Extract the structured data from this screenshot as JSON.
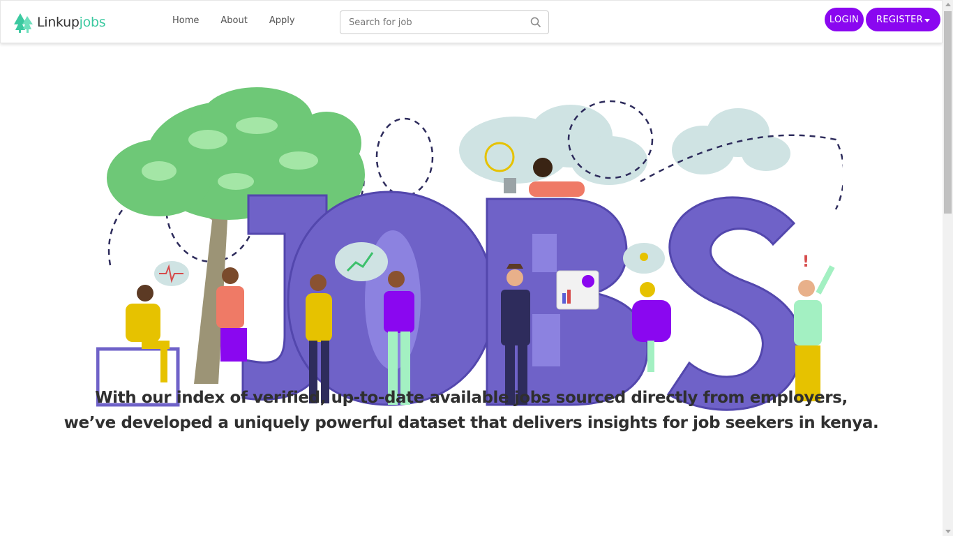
{
  "brand": {
    "part1": "Linkup",
    "part2": "jobs",
    "accent_color": "#3cc9a0"
  },
  "nav": {
    "items": [
      {
        "label": "Home"
      },
      {
        "label": "About"
      },
      {
        "label": "Apply"
      }
    ]
  },
  "search": {
    "placeholder": "Search for job",
    "icon": "search-icon"
  },
  "auth": {
    "login_label": "LOGIN",
    "register_label": "REGISTER",
    "button_color": "#8a07f0"
  },
  "hero": {
    "illustration": "jobs-people-illustration",
    "word": "JOBS"
  },
  "tagline": {
    "line1": "With our index of verified, up-to-date available jobs sourced directly from employers,",
    "line2": "we’ve developed a uniquely powerful dataset that delivers insights for job seekers in kenya."
  }
}
